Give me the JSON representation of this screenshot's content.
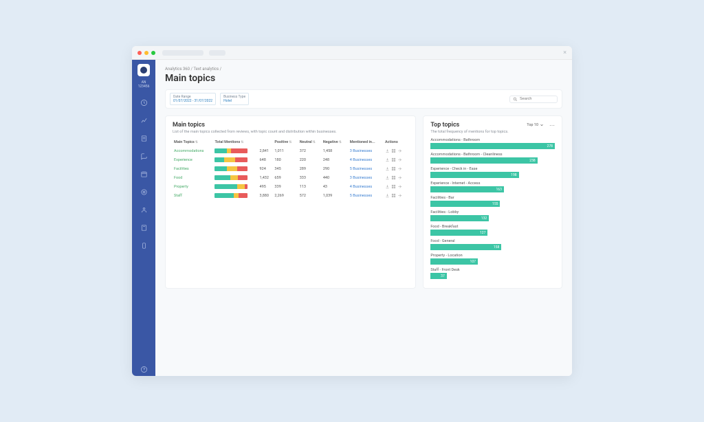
{
  "org": {
    "code": "AN",
    "id": "123456"
  },
  "breadcrumb": "Analytics 360  /  Text analytics  /",
  "page_title": "Main topics",
  "filters": {
    "date_label": "Date Range",
    "date_value": "01/07/2022 - 31/07/2022",
    "biz_label": "Business Type",
    "biz_value": "Hotel",
    "search_placeholder": "Search"
  },
  "main_card": {
    "title": "Main topics",
    "subtitle": "List of the main topics collected from reviews, with topic count and distribution within businesses.",
    "columns": {
      "topic": "Main Topics",
      "total": "Total Mentions",
      "positive": "Positive",
      "neutral": "Neutral",
      "negative": "Negative",
      "mentioned": "Mentioned in...",
      "actions": "Actions"
    },
    "rows": [
      {
        "topic": "Accommodations",
        "total": "2,841",
        "positive": "1,011",
        "neutral": "372",
        "negative": "1,458",
        "pos_pct": 36,
        "neu_pct": 13,
        "neg_pct": 51,
        "mentioned": "3 Businesses"
      },
      {
        "topic": "Experience",
        "total": "648",
        "positive": "180",
        "neutral": "220",
        "negative": "248",
        "pos_pct": 28,
        "neu_pct": 34,
        "neg_pct": 38,
        "mentioned": "4 Businesses"
      },
      {
        "topic": "Facilities",
        "total": "924",
        "positive": "345",
        "neutral": "289",
        "negative": "290",
        "pos_pct": 37,
        "neu_pct": 31,
        "neg_pct": 32,
        "mentioned": "5 Businesses"
      },
      {
        "topic": "Food",
        "total": "1,432",
        "positive": "659",
        "neutral": "333",
        "negative": "440",
        "pos_pct": 46,
        "neu_pct": 23,
        "neg_pct": 31,
        "mentioned": "3 Businesses"
      },
      {
        "topic": "Property",
        "total": "495",
        "positive": "339",
        "neutral": "113",
        "negative": "43",
        "pos_pct": 68,
        "neu_pct": 23,
        "neg_pct": 9,
        "mentioned": "4 Businesses"
      },
      {
        "topic": "Staff",
        "total": "3,880",
        "positive": "2,269",
        "neutral": "572",
        "negative": "1,039",
        "pos_pct": 58,
        "neu_pct": 15,
        "neg_pct": 27,
        "mentioned": "5 Businesses"
      }
    ]
  },
  "side_card": {
    "title": "Top topics",
    "dropdown": "Top 10",
    "subtitle": "The total frequency of mentions for top topics.",
    "max": 278,
    "items": [
      {
        "label": "Accommodations - Bathroom",
        "value": 278
      },
      {
        "label": "Accommodations - Bathroom - Cleanliness",
        "value": 238
      },
      {
        "label": "Experience - Check in - Ease",
        "value": 198
      },
      {
        "label": "Experience - Internet - Access",
        "value": 163
      },
      {
        "label": "Facilities - Bar",
        "value": 155
      },
      {
        "label": "Facilities - Lobby",
        "value": 132
      },
      {
        "label": "Food - Breakfast",
        "value": 127
      },
      {
        "label": "Food - General",
        "value": 158
      },
      {
        "label": "Property - Location",
        "value": 107
      },
      {
        "label": "Staff - Front Desk",
        "value": 37
      }
    ]
  },
  "chart_data": [
    {
      "type": "bar",
      "title": "Top topics",
      "subtitle": "The total frequency of mentions for top topics.",
      "xlabel": "",
      "ylabel": "",
      "categories": [
        "Accommodations - Bathroom",
        "Accommodations - Bathroom - Cleanliness",
        "Experience - Check in - Ease",
        "Experience - Internet - Access",
        "Facilities - Bar",
        "Facilities - Lobby",
        "Food - Breakfast",
        "Food - General",
        "Property - Location",
        "Staff - Front Desk"
      ],
      "values": [
        278,
        238,
        198,
        163,
        155,
        132,
        127,
        158,
        107,
        37
      ],
      "ylim": [
        0,
        278
      ]
    },
    {
      "type": "bar",
      "title": "Main topics sentiment distribution",
      "categories": [
        "Accommodations",
        "Experience",
        "Facilities",
        "Food",
        "Property",
        "Staff"
      ],
      "series": [
        {
          "name": "Positive",
          "values": [
            1011,
            180,
            345,
            659,
            339,
            2269
          ]
        },
        {
          "name": "Neutral",
          "values": [
            372,
            220,
            289,
            333,
            113,
            572
          ]
        },
        {
          "name": "Negative",
          "values": [
            1458,
            248,
            290,
            440,
            43,
            1039
          ]
        }
      ],
      "xlabel": "",
      "ylabel": "Mentions"
    }
  ]
}
